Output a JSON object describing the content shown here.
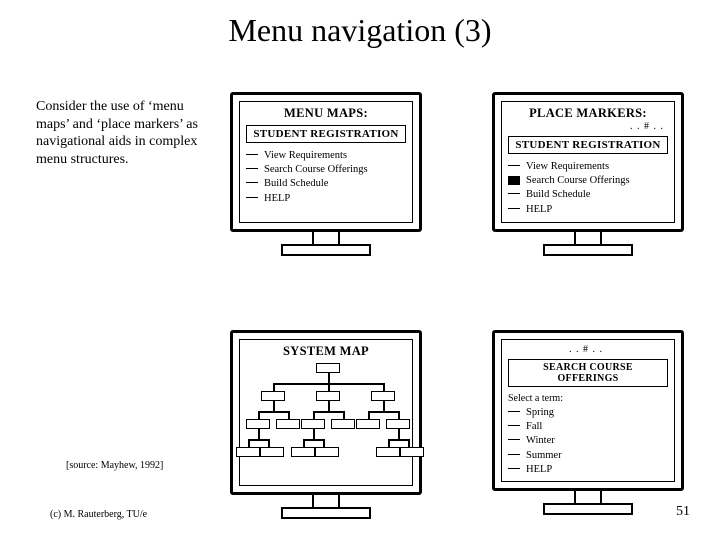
{
  "title": "Menu navigation (3)",
  "body": "Consider the use of ‘menu maps’ and ‘place markers’ as navigational aids in complex menu structures.",
  "source": "[source: Mayhew, 1992]",
  "copyright": "(c) M. Rauterberg, TU/e",
  "page": "51",
  "labels": {
    "menu_maps": "MENU MAPS:",
    "place_markers": "PLACE MARKERS:",
    "system_map": "SYSTEM MAP"
  },
  "crumb": ". . # . .",
  "registration": {
    "heading": "STUDENT REGISTRATION",
    "items": [
      "View Requirements",
      "Search Course Offerings",
      "Build Schedule",
      "HELP"
    ]
  },
  "offerings": {
    "heading": "SEARCH COURSE OFFERINGS",
    "prompt": "Select a term:",
    "items": [
      "Spring",
      "Fall",
      "Winter",
      "Summer",
      "HELP"
    ]
  }
}
